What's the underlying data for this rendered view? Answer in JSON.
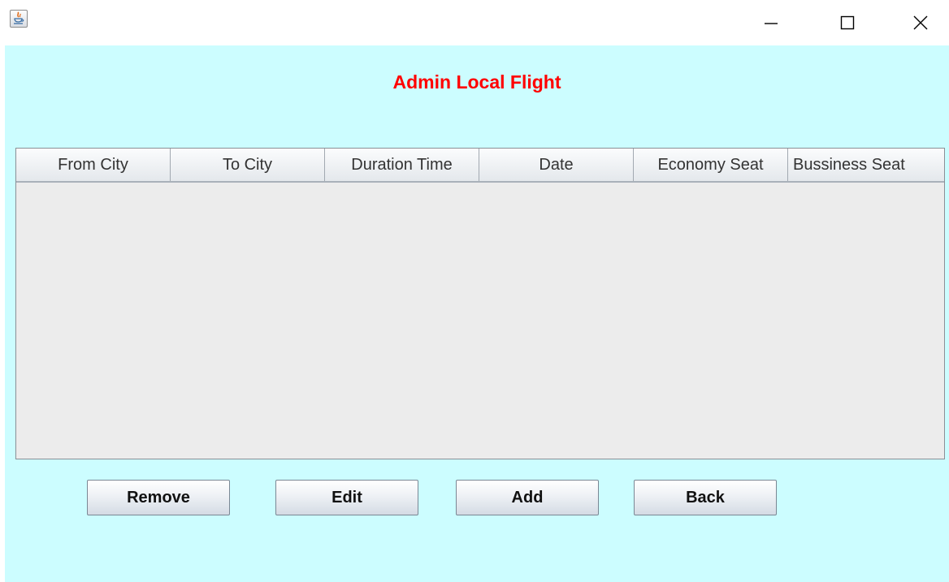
{
  "window": {
    "title": "",
    "icons": [
      "java-icon",
      "minimize-icon",
      "maximize-icon",
      "close-icon"
    ]
  },
  "heading": "Admin Local Flight",
  "colors": {
    "background": "#ccfdff",
    "heading": "#ff0000",
    "table_body": "#ececec"
  },
  "table": {
    "columns": [
      "From City",
      "To City",
      "Duration Time",
      "Date",
      "Economy Seat",
      "Bussiness Seat"
    ],
    "rows": []
  },
  "buttons": {
    "remove": "Remove",
    "edit": "Edit",
    "add": "Add",
    "back": "Back"
  }
}
